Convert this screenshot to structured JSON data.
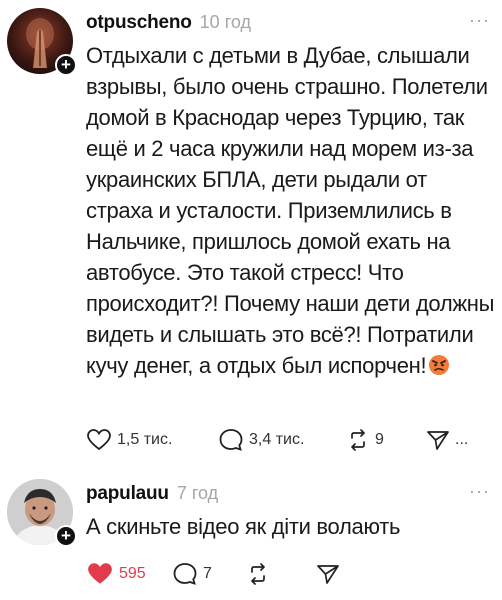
{
  "posts": [
    {
      "username": "otpuscheno",
      "time": "10 год",
      "more": "···",
      "text": "Отдыхали с детьми в Дубае, слышали взрывы, было очень страшно. Полетели домой в Краснодар через Турцию, так ещё и 2 часа кружили над морем из-за украинских БПЛА, дети рыдали от страха и усталости. Приземлились в Нальчике, пришлось домой ехать на автобусе. Это такой стресс! Что происходит?! Почему наши дети должны видеть и слышать это всё?! Потратили кучу денег, а отдых был испорчен!",
      "emoji": "angry-face",
      "likes": "1,5 тис.",
      "replies": "3,4 тис.",
      "reposts": "9",
      "shares": "..."
    },
    {
      "username": "papulauu",
      "time": "7 год",
      "more": "···",
      "text": "А скиньте відео як діти волають",
      "likes": "595",
      "replies": "7",
      "liked": true
    }
  ],
  "colors": {
    "like_active": "#e23b4e",
    "muted": "#a6a6a6",
    "text": "#1a1a1a"
  }
}
